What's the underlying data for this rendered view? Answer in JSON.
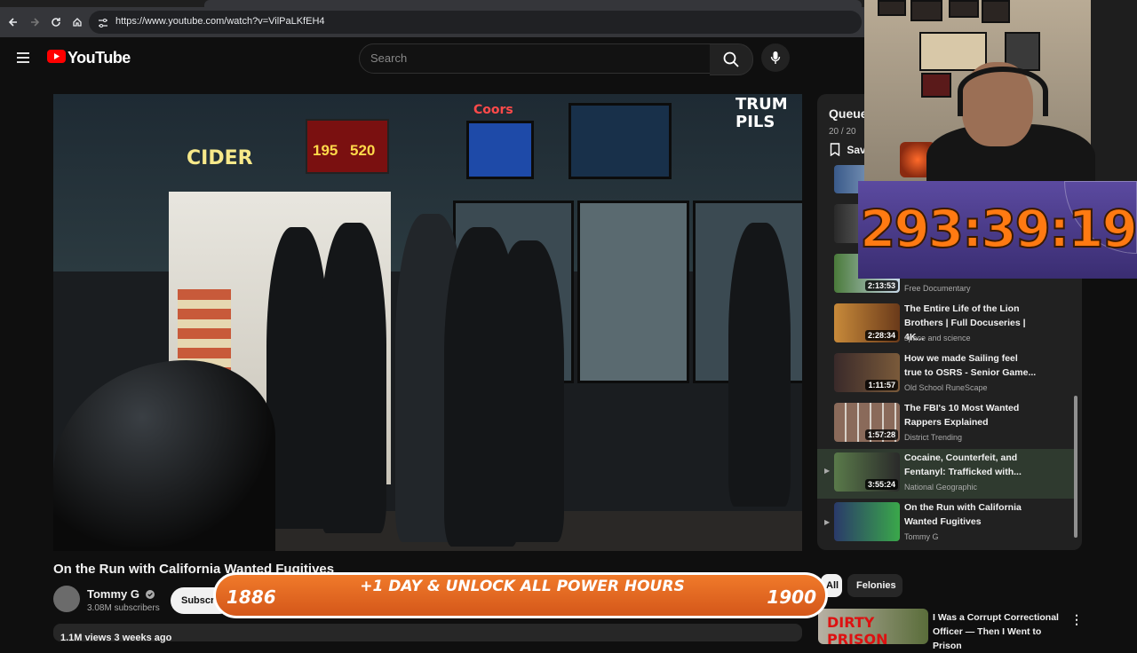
{
  "browser": {
    "url": "https://www.youtube.com/watch?v=VilPaLKfEH4"
  },
  "header": {
    "logo_text": "YouTube",
    "search_placeholder": "Search"
  },
  "video": {
    "title": "On the Run with California Wanted Fugitives",
    "lottery_left": "195",
    "lottery_right": "520",
    "sign_cider": "CIDER",
    "sign_coors": "Coors",
    "sign_pils": "TRUM\nPILS"
  },
  "channel": {
    "name": "Tommy G",
    "subscribers": "3.08M subscribers",
    "subscribe_label": "Subscribe"
  },
  "description": {
    "text": "1.1M views  3 weeks ago"
  },
  "queue": {
    "title": "Queue",
    "count": "20 / 20",
    "save_label": "Save",
    "items": [
      {
        "title": "",
        "channel": "Free Documentary",
        "duration": "2:13:53"
      },
      {
        "title": "The Entire Life of the Lion Brothers | Full Docuseries | 4K...",
        "channel": "space and science",
        "duration": "2:28:34"
      },
      {
        "title": "How we made Sailing feel true to OSRS - Senior Game...",
        "channel": "Old School RuneScape",
        "duration": "1:11:57"
      },
      {
        "title": "The FBI's 10 Most Wanted Rappers Explained",
        "channel": "District Trending",
        "duration": "1:57:28"
      },
      {
        "title": "Cocaine, Counterfeit, and Fentanyl: Trafficked with...",
        "channel": "National Geographic",
        "duration": "3:55:24"
      },
      {
        "title": "On the Run with California Wanted Fugitives",
        "channel": "Tommy G",
        "duration": ""
      }
    ]
  },
  "chips": {
    "all": "All",
    "felonies": "Felonies"
  },
  "recommended": {
    "thumb_text": "DIRTY PRISON",
    "title": "I Was a Corrupt Correctional Officer — Then I Went to Prison"
  },
  "overlay": {
    "timer": "293:39:19",
    "banner_left": "1886",
    "banner_mid": "+1 DAY & UNLOCK ALL POWER HOURS",
    "banner_right": "1900"
  },
  "colors": {
    "background": "#0f0f0f",
    "accent_red": "#ff0000",
    "timer_orange": "#ff7a12",
    "banner_orange": "#e8641f"
  }
}
